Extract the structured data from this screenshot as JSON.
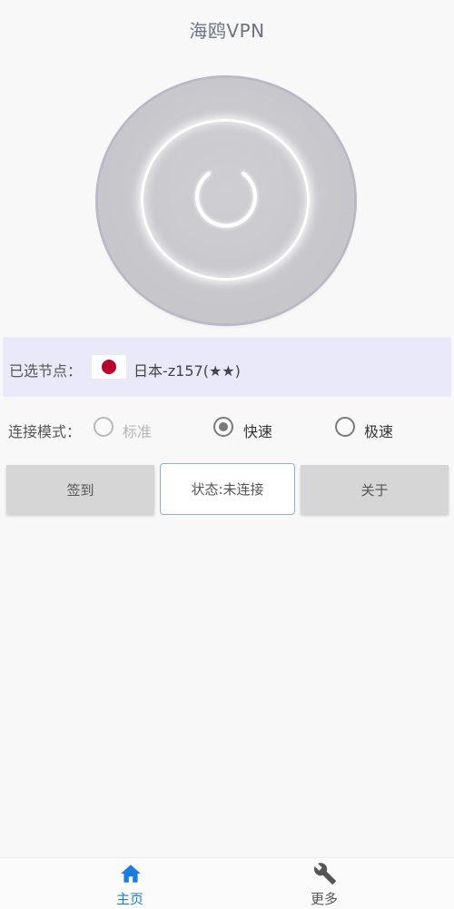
{
  "header": {
    "title": "海鸥VPN"
  },
  "power": {
    "icon": "power-icon",
    "glow_color": "#ffffff"
  },
  "node": {
    "label": "已选节点：",
    "flag": "japan-flag",
    "name": "日本-z157(★★)"
  },
  "mode": {
    "label": "连接模式：",
    "options": [
      {
        "label": "标准",
        "selected": false,
        "enabled": false
      },
      {
        "label": "快速",
        "selected": true,
        "enabled": true
      },
      {
        "label": "极速",
        "selected": false,
        "enabled": true
      }
    ]
  },
  "buttons": {
    "checkin": "签到",
    "status": "状态:未连接",
    "about": "关于"
  },
  "nav": {
    "items": [
      {
        "label": "主页",
        "icon": "home-icon",
        "active": true,
        "color": "#1a7ee0"
      },
      {
        "label": "更多",
        "icon": "wrench-icon",
        "active": false,
        "color": "#555555"
      }
    ]
  },
  "colors": {
    "accent": "#1a7ee0",
    "node_bar_bg": "#e9e9fa",
    "status_border": "#8bb3c5"
  }
}
